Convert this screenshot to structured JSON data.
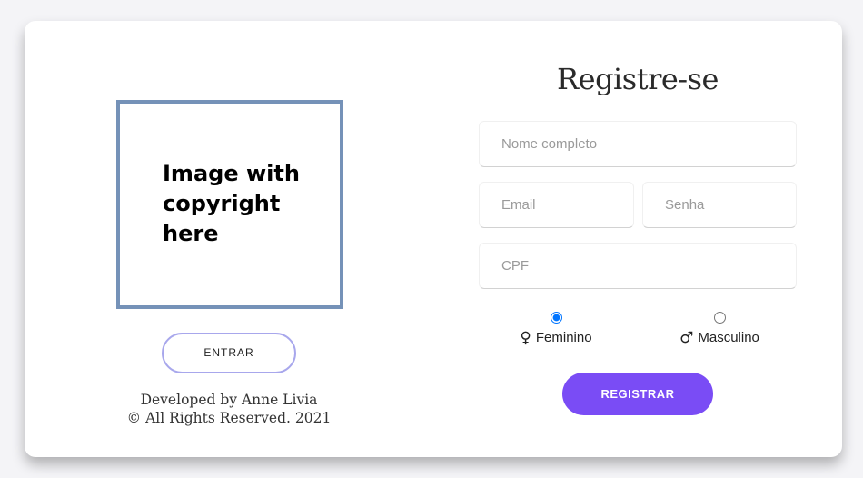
{
  "left_panel": {
    "image_placeholder_text": "Image with copyright here",
    "login_button_label": "ENTRAR",
    "credits_line1": "Developed by Anne Livia",
    "credits_line2": "© All Rights Reserved. 2021"
  },
  "form": {
    "title": "Registre-se",
    "name_placeholder": "Nome completo",
    "email_placeholder": "Email",
    "password_placeholder": "Senha",
    "cpf_placeholder": "CPF",
    "gender_options": [
      {
        "label": "Feminino",
        "icon": "female-sign-icon",
        "selected": true
      },
      {
        "label": "Masculino",
        "icon": "male-sign-icon",
        "selected": false
      }
    ],
    "submit_label": "REGISTRAR"
  },
  "colors": {
    "accent": "#7a4cf5",
    "image_border": "#7592b8",
    "login_border": "#a8a7ec"
  }
}
